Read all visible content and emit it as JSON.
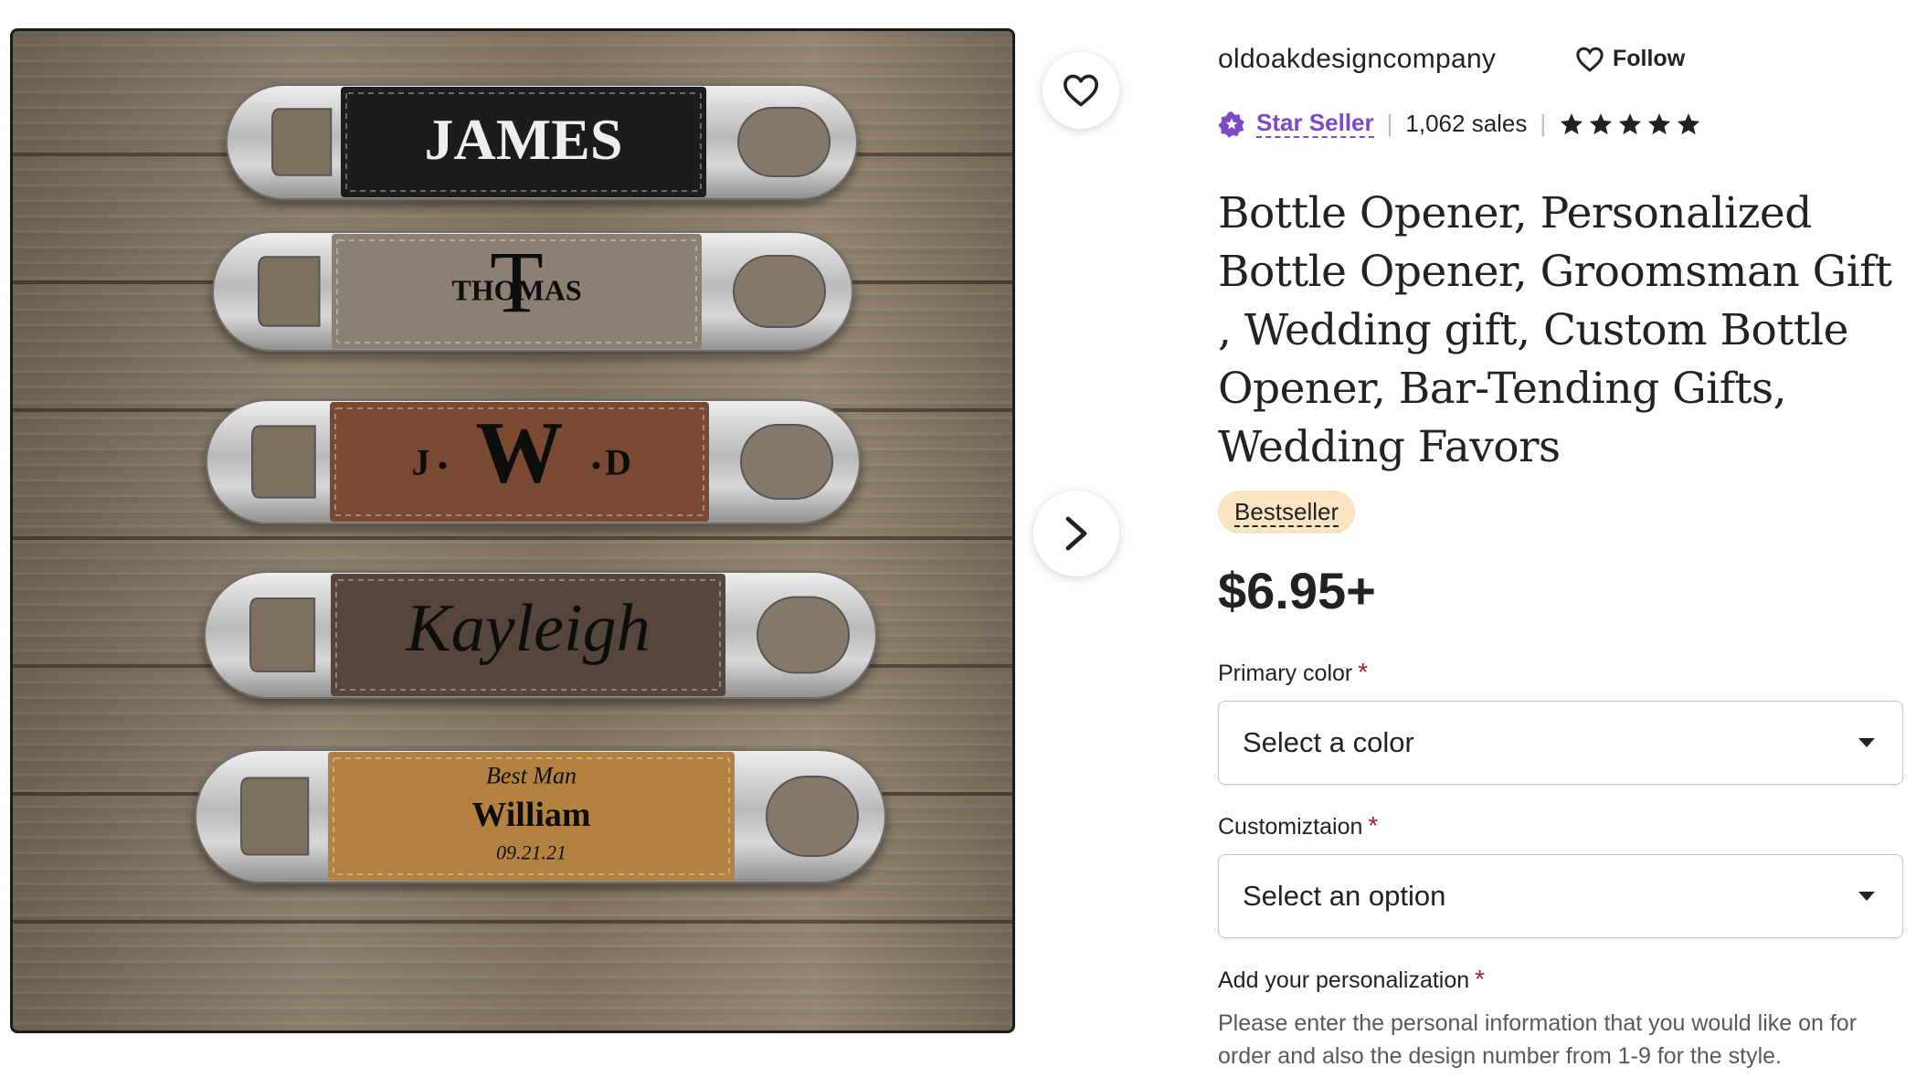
{
  "image": {
    "openers": [
      {
        "text": "JAMES"
      },
      {
        "text": "THOMAS",
        "monogram": "T"
      },
      {
        "left": "J",
        "center": "W",
        "right": "D"
      },
      {
        "text": "Kayleigh"
      },
      {
        "top": "Best Man",
        "text": "William",
        "bottom": "09.21.21"
      }
    ],
    "leather_colors": [
      "#1d1d1f",
      "#8b8074",
      "#7a4a33",
      "#54443d",
      "#b3823f"
    ]
  },
  "shop": {
    "name": "oldoakdesigncompany",
    "follow_label": "Follow",
    "star_seller_label": "Star Seller",
    "sales": "1,062 sales",
    "rating_stars": 5
  },
  "product": {
    "title": "Bottle Opener, Personalized Bottle Opener, Groomsman Gift , Wedding gift, Custom Bottle Opener, Bar-Tending Gifts, Wedding Favors",
    "badge": "Bestseller",
    "price": "$6.95+"
  },
  "options": {
    "primary_color_label": "Primary color",
    "primary_color_value": "Select a color",
    "customization_label": "Customiztaion",
    "customization_value": "Select an option",
    "personalization_label": "Add your personalization",
    "required_mark": "*",
    "personalization_help": "Please enter the personal information that you would like on for order and also the design number from 1-9 for the style."
  },
  "colors": {
    "accent_purple": "#7d4bc6",
    "required_red": "#a51e29",
    "badge_bg": "#fae4c2"
  },
  "icons": {
    "favorite": "heart-icon",
    "next": "chevron-right-icon",
    "follow": "heart-icon",
    "star_seller": "star-seller-icon",
    "rating": "star-icon",
    "dropdown": "caret-down-icon"
  }
}
